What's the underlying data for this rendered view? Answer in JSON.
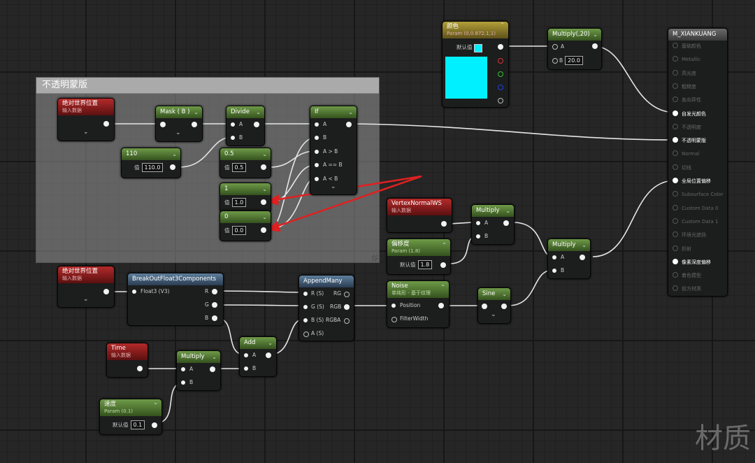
{
  "comment_title": "不透明蒙版",
  "nodes": {
    "color_param": {
      "title": "颜色",
      "sub": "Param (0,0.872,1,1)",
      "label": "默认值",
      "swatch": "#00F0FF"
    },
    "multiply20": {
      "title": "Multiply(,20)",
      "pin_a": "A",
      "pin_b": "B",
      "b_value": "20.0"
    },
    "material": {
      "title": "M_XIANKUANG",
      "pins": [
        "基础颜色",
        "Metallic",
        "高光度",
        "粗糙度",
        "各向异性",
        "自发光颜色",
        "不透明度",
        "不透明蒙版",
        "Normal",
        "切线",
        "全局位置偏移",
        "Subsurface Color",
        "Custom Data 0",
        "Custom Data 1",
        "环境光遮挡",
        "折射",
        "像素深度偏移",
        "着色模型",
        "前方材质"
      ],
      "active": [
        5,
        7,
        10,
        16
      ]
    },
    "absworld1": {
      "title": "绝对世界位置",
      "sub": "输入数据"
    },
    "mask_b": {
      "title": "Mask ( B )"
    },
    "divide": {
      "title": "Divide",
      "pin_a": "A",
      "pin_b": "B"
    },
    "if_node": {
      "title": "If",
      "pins": [
        "A",
        "B",
        "A > B",
        "A == B",
        "A < B"
      ]
    },
    "const110": {
      "title": "110",
      "label": "值",
      "value": "110.0"
    },
    "const05": {
      "title": "0.5",
      "label": "值",
      "value": "0.5"
    },
    "const1": {
      "title": "1",
      "label": "值",
      "value": "1.0"
    },
    "const0": {
      "title": "0",
      "label": "值",
      "value": "0.0"
    },
    "vertexnormal": {
      "title": "VertexNormalWS",
      "sub": "输入数据"
    },
    "multiply_a": {
      "title": "Multiply",
      "pin_a": "A",
      "pin_b": "B"
    },
    "offset_param": {
      "title": "偏移度",
      "sub": "Param (1.8)",
      "label": "默认值",
      "value": "1.8"
    },
    "multiply_b": {
      "title": "Multiply",
      "pin_a": "A",
      "pin_b": "B"
    },
    "absworld2": {
      "title": "绝对世界位置",
      "sub": "输入数据"
    },
    "breakout": {
      "title": "BreakOutFloat3Components",
      "input": "Float3 (V3)",
      "outs": [
        "R",
        "G",
        "B"
      ]
    },
    "appendmany": {
      "title": "AppendMany",
      "ins": [
        "R (S)",
        "G (S)",
        "B (S)",
        "A (S)"
      ],
      "outs": [
        "RG",
        "RGB",
        "RGBA"
      ]
    },
    "noise": {
      "title": "Noise",
      "sub": "单纯形 - 基于纹理",
      "pin_pos": "Position",
      "pin_fw": "FilterWidth"
    },
    "sine": {
      "title": "Sine"
    },
    "add": {
      "title": "Add",
      "pin_a": "A",
      "pin_b": "B"
    },
    "time": {
      "title": "Time",
      "sub": "输入数据"
    },
    "multiply_c": {
      "title": "Multiply",
      "pin_a": "A",
      "pin_b": "B"
    },
    "speed_param": {
      "title": "速度",
      "sub": "Param (0.1)",
      "label": "默认值",
      "value": "0.1"
    }
  },
  "watermark": "材质",
  "colors": {
    "wire": "#e6e6e6",
    "arrow": "#e02020",
    "swatch": "#00F0FF"
  }
}
